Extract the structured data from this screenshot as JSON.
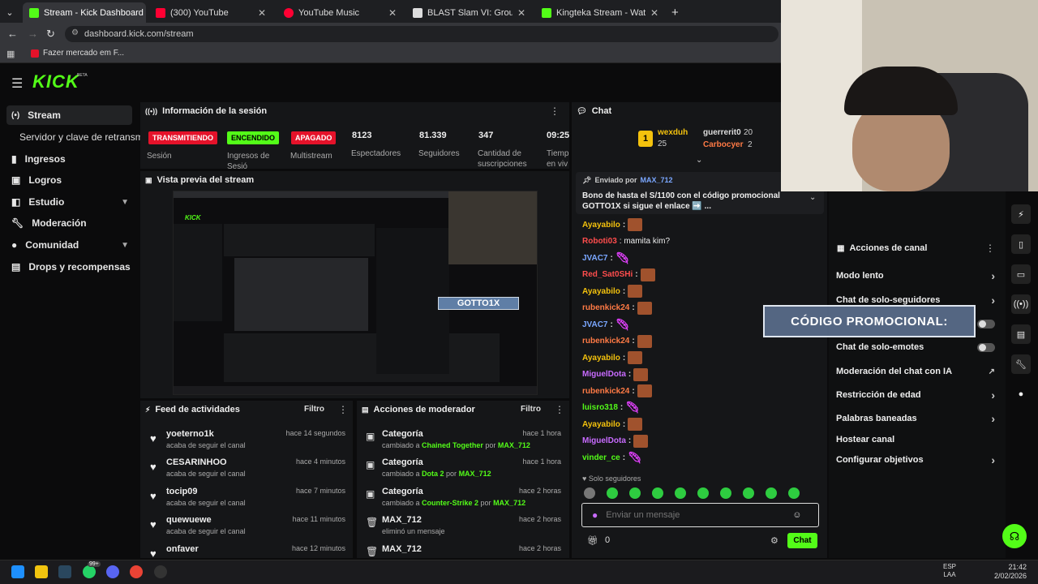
{
  "browser": {
    "tabs": [
      {
        "label": "Stream - Kick Dashboard",
        "active": true
      },
      {
        "label": "(300) YouTube"
      },
      {
        "label": "YouTube Music"
      },
      {
        "label": "BLAST Slam VI: Group Stage - L"
      },
      {
        "label": "Kingteka Stream - Watch Live o"
      }
    ],
    "url": "dashboard.kick.com/stream",
    "bookmark": "Fazer mercado em F..."
  },
  "logo": "KICK",
  "logo_beta": "BETA",
  "sidebar": {
    "items": [
      {
        "label": "Stream"
      },
      {
        "label": "Servidor y clave de retransm"
      },
      {
        "label": "Ingresos"
      },
      {
        "label": "Logros"
      },
      {
        "label": "Estudio"
      },
      {
        "label": "Moderación"
      },
      {
        "label": "Comunidad"
      },
      {
        "label": "Drops y recompensas"
      }
    ]
  },
  "session": {
    "title": "Información de la sesión",
    "badges": [
      {
        "text": "TRANSMITIENDO",
        "label": "Sesión"
      },
      {
        "text": "ENCENDIDO",
        "label": "Ingresos de Sesió"
      },
      {
        "text": "APAGADO",
        "label": "Multistream"
      }
    ],
    "stats": [
      {
        "value": "8123",
        "label": "Espectadores"
      },
      {
        "value": "81.339",
        "label": "Seguidores"
      },
      {
        "value": "347",
        "label": "Cantidad de suscripciones"
      },
      {
        "value": "09:25:",
        "label": "Tiemp en viv"
      }
    ]
  },
  "preview": {
    "title": "Vista previa del stream",
    "overlay": "GOTTO1X"
  },
  "feed": {
    "title": "Feed de actividades",
    "filter": "Filtro",
    "items": [
      {
        "name": "yoeterno1k",
        "sub": "acaba de seguir el canal",
        "time": "hace 14 segundos"
      },
      {
        "name": "CESARINHOO",
        "sub": "acaba de seguir el canal",
        "time": "hace 4 minutos"
      },
      {
        "name": "tocip09",
        "sub": "acaba de seguir el canal",
        "time": "hace 7 minutos"
      },
      {
        "name": "quewuewe",
        "sub": "acaba de seguir el canal",
        "time": "hace 11 minutos"
      },
      {
        "name": "onfaver",
        "sub": "",
        "time": "hace 12 minutos"
      }
    ]
  },
  "modactions": {
    "title": "Acciones de moderador",
    "filter": "Filtro",
    "items": [
      {
        "title": "Categoría",
        "pre": "cambiado a ",
        "target": "Chained Together",
        "mid": " por ",
        "by": "MAX_712",
        "time": "hace 1 hora"
      },
      {
        "title": "Categoría",
        "pre": "cambiado a ",
        "target": "Dota 2",
        "mid": " por ",
        "by": "MAX_712",
        "time": "hace 1 hora"
      },
      {
        "title": "Categoría",
        "pre": "cambiado a ",
        "target": "Counter-Strike 2",
        "mid": " por ",
        "by": "MAX_712",
        "time": "hace 2 horas"
      },
      {
        "title": "MAX_712",
        "pre": "eliminó un mensaje",
        "target": "",
        "mid": "",
        "by": "",
        "time": "hace 2 horas"
      },
      {
        "title": "MAX_712",
        "pre": "",
        "target": "",
        "mid": "",
        "by": "",
        "time": "hace 2 horas"
      }
    ]
  },
  "chat": {
    "title": "Chat",
    "leaders": [
      {
        "rank": "1",
        "name": "wexduh",
        "count": "25"
      },
      {
        "name": "guerrerit0",
        "count": "20"
      },
      {
        "name": "Carbocyer",
        "count": "2"
      }
    ],
    "pinned_by_label": "Enviado por",
    "pinned_by": "MAX_712",
    "pinned_text": "Bono de hasta el S/1100 con el código promocional GOTTO1X si sigue el enlace ➡️ ...",
    "messages": [
      {
        "user": "Ayayabilo",
        "text": "",
        "color": "#f4c20d",
        "emote": "img"
      },
      {
        "user": "Roboti03",
        "text": ": mamita kim?",
        "color": "#ff4d4d",
        "emote": ""
      },
      {
        "user": "JVAC7",
        "text": "",
        "color": "#7aa7ff",
        "emote": "pink"
      },
      {
        "user": "Red_Sat0SHi",
        "text": "",
        "color": "#ff4d4d",
        "emote": "img"
      },
      {
        "user": "Ayayabilo",
        "text": "",
        "color": "#f4c20d",
        "emote": "img"
      },
      {
        "user": "rubenkick24",
        "text": "",
        "color": "#ff7a45",
        "emote": "img"
      },
      {
        "user": "JVAC7",
        "text": "",
        "color": "#7aa7ff",
        "emote": "pink"
      },
      {
        "user": "rubenkick24",
        "text": "",
        "color": "#ff7a45",
        "emote": "img"
      },
      {
        "user": "Ayayabilo",
        "text": "",
        "color": "#f4c20d",
        "emote": "img"
      },
      {
        "user": "MiguelDota",
        "text": "",
        "color": "#c86bff",
        "emote": "img"
      },
      {
        "user": "rubenkick24",
        "text": "",
        "color": "#ff7a45",
        "emote": "img"
      },
      {
        "user": "luisro318",
        "text": "",
        "color": "#53fc18",
        "emote": "pink"
      },
      {
        "user": "Ayayabilo",
        "text": "",
        "color": "#f4c20d",
        "emote": "img"
      },
      {
        "user": "MiguelDota",
        "text": "",
        "color": "#c86bff",
        "emote": "img"
      },
      {
        "user": "vinder_ce",
        "text": "",
        "color": "#53fc18",
        "emote": "pink"
      }
    ],
    "mode": "Solo seguidores",
    "placeholder": "Enviar un mensaje",
    "points": "0",
    "send": "Chat"
  },
  "channel_actions": {
    "title": "Acciones de canal",
    "items": [
      {
        "label": "Modo lento",
        "kind": "arrow"
      },
      {
        "label": "Chat de solo-seguidores",
        "kind": "arrow"
      },
      {
        "label": "",
        "kind": "toggle"
      },
      {
        "label": "Chat de solo-emotes",
        "kind": "toggle"
      },
      {
        "label": "Moderación del chat con IA",
        "kind": "ext"
      },
      {
        "label": "Restricción de edad",
        "kind": "arrow"
      },
      {
        "label": "Palabras baneadas",
        "kind": "arrow"
      },
      {
        "label": "Hostear canal",
        "kind": "none"
      },
      {
        "label": "Configurar objetivos",
        "kind": "arrow"
      }
    ],
    "promo_overlay": "CÓDIGO PROMOCIONAL:"
  },
  "taskbar": {
    "lang": "ESP",
    "lang2": "LAA",
    "time": "21:42",
    "date": "2/02/2026",
    "badge": "99+"
  },
  "colors": {
    "accent": "#53fc18",
    "red": "#e5122a"
  }
}
